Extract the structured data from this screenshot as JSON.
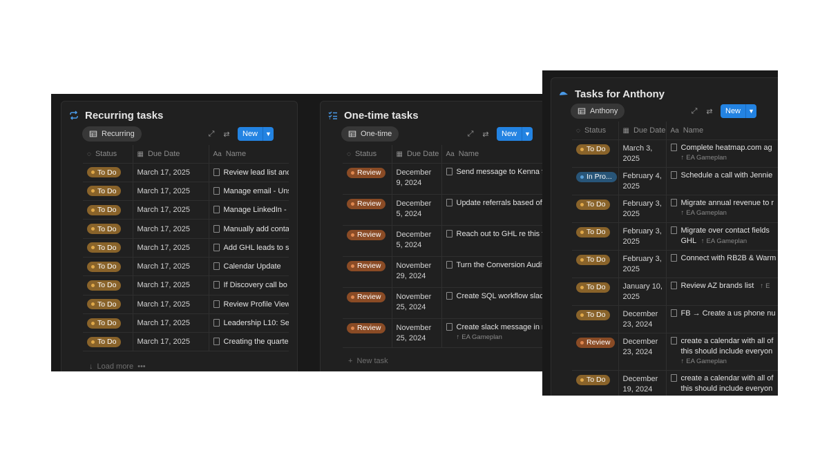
{
  "recurring": {
    "title": "Recurring tasks",
    "view_label": "Recurring",
    "new_label": "New",
    "columns": {
      "status": "Status",
      "due": "Due Date",
      "name": "Name"
    },
    "rows": [
      {
        "status": "To Do",
        "due": "March 17, 2025",
        "name": "Review lead list and"
      },
      {
        "status": "To Do",
        "due": "March 17, 2025",
        "name": "Manage email - Uns"
      },
      {
        "status": "To Do",
        "due": "March 17, 2025",
        "name": "Manage LinkedIn -"
      },
      {
        "status": "To Do",
        "due": "March 17, 2025",
        "name": "Manually add conta"
      },
      {
        "status": "To Do",
        "due": "March 17, 2025",
        "name": "Add GHL leads to s"
      },
      {
        "status": "To Do",
        "due": "March 17, 2025",
        "name": "Calendar Update"
      },
      {
        "status": "To Do",
        "due": "March 17, 2025",
        "name": "If Discovery call bo"
      },
      {
        "status": "To Do",
        "due": "March 17, 2025",
        "name": "Review Profile View"
      },
      {
        "status": "To Do",
        "due": "March 17, 2025",
        "name": "Leadership L10: Se"
      },
      {
        "status": "To Do",
        "due": "March 17, 2025",
        "name": "Creating the quarte"
      }
    ],
    "load_more": "Load more",
    "more_dots": "•••"
  },
  "onetime": {
    "title": "One-time tasks",
    "view_label": "One-time",
    "new_label": "New",
    "columns": {
      "status": "Status",
      "due": "Due Date",
      "name": "Name"
    },
    "rows": [
      {
        "status": "Review",
        "due1": "December",
        "due2": "9, 2024",
        "name": "Send message to Kenna fo",
        "sub": ""
      },
      {
        "status": "Review",
        "due1": "December",
        "due2": "5, 2024",
        "name": "Update referrals based off",
        "sub": ""
      },
      {
        "status": "Review",
        "due1": "December",
        "due2": "5, 2024",
        "name": "Reach out to GHL  re this t",
        "sub": ""
      },
      {
        "status": "Review",
        "due1": "November",
        "due2": "29, 2024",
        "name": "Turn the Conversion Audit",
        "sub": ""
      },
      {
        "status": "Review",
        "due1": "November",
        "due2": "25, 2024",
        "name": "Create SQL workflow slack",
        "sub": ""
      },
      {
        "status": "Review",
        "due1": "November",
        "due2": "25, 2024",
        "name": "Create slack message in n",
        "sub": "EA Gameplan"
      }
    ],
    "new_task": "New task"
  },
  "anthony": {
    "title": "Tasks for Anthony",
    "view_label": "Anthony",
    "new_label": "New",
    "columns": {
      "status": "Status",
      "due": "Due Date",
      "name": "Name"
    },
    "rows": [
      {
        "status": "To Do",
        "kind": "todo",
        "due1": "March 3,",
        "due2": "2025",
        "name": "Complete heatmap.com ag",
        "name2": "",
        "sub": "EA Gameplan"
      },
      {
        "status": "In Pro...",
        "kind": "prog",
        "due1": "February 4,",
        "due2": "2025",
        "name": "Schedule a call with Jennie",
        "name2": "",
        "sub": ""
      },
      {
        "status": "To Do",
        "kind": "todo",
        "due1": "February 3,",
        "due2": "2025",
        "name": "Migrate annual revenue to r",
        "name2": "",
        "sub": "EA Gameplan"
      },
      {
        "status": "To Do",
        "kind": "todo",
        "due1": "February 3,",
        "due2": "2025",
        "name": "Migrate over contact fields",
        "name2": "GHL",
        "sub": "EA Gameplan"
      },
      {
        "status": "To Do",
        "kind": "todo",
        "due1": "February 3,",
        "due2": "2025",
        "name": "Connect with RB2B & Warm",
        "name2": "",
        "sub": ""
      },
      {
        "status": "To Do",
        "kind": "todo",
        "due1": "January 10,",
        "due2": "2025",
        "name": "Review AZ brands list",
        "name2": "",
        "sub": "E"
      },
      {
        "status": "To Do",
        "kind": "todo",
        "due1": "December",
        "due2": "23, 2024",
        "name": "FB → Create a us phone nu",
        "name2": "",
        "sub": ""
      },
      {
        "status": "Review",
        "kind": "review",
        "due1": "December",
        "due2": "23, 2024",
        "name": "create a calendar with all of",
        "name2": "this should include everyon",
        "sub": "EA Gameplan"
      },
      {
        "status": "To Do",
        "kind": "todo",
        "due1": "December",
        "due2": "19, 2024",
        "name": "create a calendar with all of",
        "name2": "this should include everyon",
        "sub": ""
      }
    ]
  },
  "colors": {
    "accent": "#2383e2",
    "todo": "#89632a",
    "review": "#8a4b25",
    "in_progress": "#285578"
  }
}
